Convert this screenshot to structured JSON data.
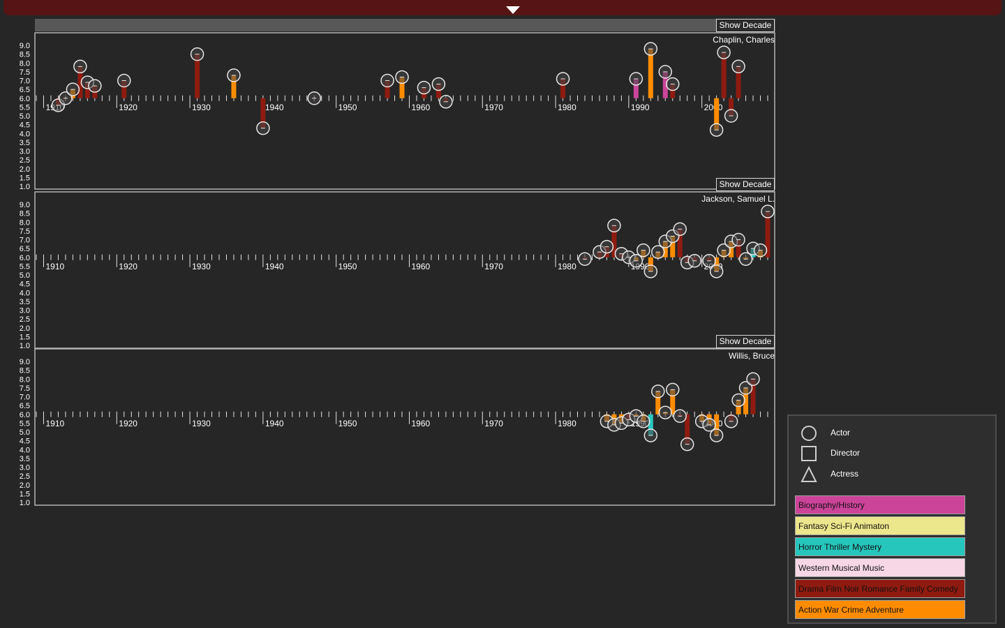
{
  "app": {
    "toggle_icon": "triangle-down-icon",
    "bar_color": "#561414"
  },
  "controls": {
    "show_decade_label": "Show Decade"
  },
  "axis": {
    "y_ticks": [
      "9.0",
      "8.5",
      "8.0",
      "7.5",
      "7.0",
      "6.5",
      "6.0",
      "5.5",
      "5.0",
      "4.5",
      "4.0",
      "3.5",
      "3.0",
      "2.5",
      "2.0",
      "1.5",
      "1.0"
    ],
    "x_decades": [
      "1910",
      "1920",
      "1930",
      "1940",
      "1950",
      "1960",
      "1970",
      "1980",
      "1990",
      "2000"
    ]
  },
  "legend": {
    "roles": [
      {
        "shape": "circle",
        "label": "Actor"
      },
      {
        "shape": "square",
        "label": "Director"
      },
      {
        "shape": "triangle",
        "label": "Actress"
      }
    ],
    "genres": [
      {
        "key": "bio",
        "label": "Biography/History",
        "color": "#cc4499"
      },
      {
        "key": "fantasy",
        "label": "Fantasy Sci-Fi Animaton",
        "color": "#ece68c"
      },
      {
        "key": "horror",
        "label": "Horror Thriller Mystery",
        "color": "#26c6bd"
      },
      {
        "key": "western",
        "label": "Western Musical Music",
        "color": "#f7d7e5"
      },
      {
        "key": "drama",
        "label": "Drama Film Noir Romance Family Comedy",
        "color": "#8f1b10"
      },
      {
        "key": "action",
        "label": "Action War Crime Adventure",
        "color": "#ff8c00"
      }
    ]
  },
  "chart_data": [
    {
      "type": "bar",
      "title": "Chaplin, Charles",
      "xlim": [
        1909,
        2009
      ],
      "ylim": [
        1.0,
        9.0
      ],
      "baseline": 6.0,
      "points": [
        {
          "year": 1912,
          "rating": 5.6,
          "genre": "drama",
          "role": "actor"
        },
        {
          "year": 1913,
          "rating": 6.0,
          "genre": "drama",
          "role": "actor"
        },
        {
          "year": 1914,
          "rating": 6.5,
          "genre": "action",
          "role": "actor"
        },
        {
          "year": 1915,
          "rating": 7.8,
          "genre": "drama",
          "role": "actor"
        },
        {
          "year": 1916,
          "rating": 6.9,
          "genre": "drama",
          "role": "actor"
        },
        {
          "year": 1917,
          "rating": 6.7,
          "genre": "drama",
          "role": "actor"
        },
        {
          "year": 1921,
          "rating": 7.0,
          "genre": "drama",
          "role": "actor"
        },
        {
          "year": 1931,
          "rating": 8.5,
          "genre": "drama",
          "role": "actor"
        },
        {
          "year": 1936,
          "rating": 7.3,
          "genre": "action",
          "role": "actor"
        },
        {
          "year": 1940,
          "rating": 4.3,
          "genre": "drama",
          "role": "actor"
        },
        {
          "year": 1947,
          "rating": 6.0,
          "genre": "drama",
          "role": "actor"
        },
        {
          "year": 1957,
          "rating": 7.0,
          "genre": "drama",
          "role": "actor"
        },
        {
          "year": 1959,
          "rating": 7.2,
          "genre": "action",
          "role": "actor"
        },
        {
          "year": 1962,
          "rating": 6.6,
          "genre": "drama",
          "role": "actor"
        },
        {
          "year": 1964,
          "rating": 6.8,
          "genre": "drama",
          "role": "actor"
        },
        {
          "year": 1965,
          "rating": 5.8,
          "genre": "drama",
          "role": "actor"
        },
        {
          "year": 1981,
          "rating": 7.1,
          "genre": "drama",
          "role": "actor"
        },
        {
          "year": 1991,
          "rating": 7.1,
          "genre": "bio",
          "role": "actor"
        },
        {
          "year": 1993,
          "rating": 8.8,
          "genre": "action",
          "role": "actor"
        },
        {
          "year": 1995,
          "rating": 7.5,
          "genre": "bio",
          "role": "actor"
        },
        {
          "year": 1996,
          "rating": 6.8,
          "genre": "drama",
          "role": "actor"
        },
        {
          "year": 2002,
          "rating": 4.2,
          "genre": "action",
          "role": "actor"
        },
        {
          "year": 2003,
          "rating": 8.6,
          "genre": "drama",
          "role": "actor"
        },
        {
          "year": 2004,
          "rating": 5.0,
          "genre": "drama",
          "role": "actor"
        },
        {
          "year": 2005,
          "rating": 7.8,
          "genre": "drama",
          "role": "actor"
        }
      ]
    },
    {
      "type": "bar",
      "title": "Jackson, Samuel L.",
      "xlim": [
        1909,
        2009
      ],
      "ylim": [
        1.0,
        9.0
      ],
      "baseline": 6.0,
      "points": [
        {
          "year": 1984,
          "rating": 5.9,
          "genre": "drama",
          "role": "actor"
        },
        {
          "year": 1986,
          "rating": 6.3,
          "genre": "drama",
          "role": "actor"
        },
        {
          "year": 1987,
          "rating": 6.6,
          "genre": "drama",
          "role": "actor"
        },
        {
          "year": 1988,
          "rating": 7.8,
          "genre": "drama",
          "role": "actor"
        },
        {
          "year": 1989,
          "rating": 6.2,
          "genre": "drama",
          "role": "actor"
        },
        {
          "year": 1990,
          "rating": 6.0,
          "genre": "drama",
          "role": "actor"
        },
        {
          "year": 1991,
          "rating": 5.8,
          "genre": "action",
          "role": "actor"
        },
        {
          "year": 1992,
          "rating": 6.4,
          "genre": "action",
          "role": "actor"
        },
        {
          "year": 1993,
          "rating": 5.2,
          "genre": "action",
          "role": "actor"
        },
        {
          "year": 1994,
          "rating": 6.3,
          "genre": "action",
          "role": "actor"
        },
        {
          "year": 1995,
          "rating": 6.9,
          "genre": "action",
          "role": "actor"
        },
        {
          "year": 1996,
          "rating": 7.2,
          "genre": "action",
          "role": "actor"
        },
        {
          "year": 1997,
          "rating": 7.6,
          "genre": "drama",
          "role": "actor"
        },
        {
          "year": 1998,
          "rating": 5.7,
          "genre": "drama",
          "role": "actor"
        },
        {
          "year": 1999,
          "rating": 5.8,
          "genre": "drama",
          "role": "actor"
        },
        {
          "year": 2001,
          "rating": 5.8,
          "genre": "drama",
          "role": "actor"
        },
        {
          "year": 2002,
          "rating": 5.2,
          "genre": "action",
          "role": "actor"
        },
        {
          "year": 2003,
          "rating": 6.4,
          "genre": "action",
          "role": "actor"
        },
        {
          "year": 2004,
          "rating": 6.9,
          "genre": "action",
          "role": "actor"
        },
        {
          "year": 2005,
          "rating": 7.0,
          "genre": "drama",
          "role": "actor"
        },
        {
          "year": 2006,
          "rating": 5.9,
          "genre": "action",
          "role": "actor"
        },
        {
          "year": 2007,
          "rating": 6.5,
          "genre": "horror",
          "role": "actor"
        },
        {
          "year": 2008,
          "rating": 6.4,
          "genre": "action",
          "role": "actor"
        },
        {
          "year": 2009,
          "rating": 8.6,
          "genre": "drama",
          "role": "actor"
        }
      ]
    },
    {
      "type": "bar",
      "title": "Willis, Bruce",
      "xlim": [
        1909,
        2009
      ],
      "ylim": [
        1.0,
        9.0
      ],
      "baseline": 6.0,
      "points": [
        {
          "year": 1987,
          "rating": 5.6,
          "genre": "action",
          "role": "actor"
        },
        {
          "year": 1988,
          "rating": 5.4,
          "genre": "action",
          "role": "actor"
        },
        {
          "year": 1989,
          "rating": 5.5,
          "genre": "action",
          "role": "actor"
        },
        {
          "year": 1990,
          "rating": 5.7,
          "genre": "drama",
          "role": "actor"
        },
        {
          "year": 1991,
          "rating": 5.9,
          "genre": "action",
          "role": "actor"
        },
        {
          "year": 1992,
          "rating": 5.6,
          "genre": "action",
          "role": "actor"
        },
        {
          "year": 1993,
          "rating": 4.8,
          "genre": "horror",
          "role": "actor"
        },
        {
          "year": 1994,
          "rating": 7.3,
          "genre": "action",
          "role": "actor"
        },
        {
          "year": 1995,
          "rating": 6.1,
          "genre": "action",
          "role": "actor"
        },
        {
          "year": 1996,
          "rating": 7.4,
          "genre": "action",
          "role": "actor"
        },
        {
          "year": 1997,
          "rating": 5.9,
          "genre": "drama",
          "role": "actor"
        },
        {
          "year": 1998,
          "rating": 4.3,
          "genre": "drama",
          "role": "actor"
        },
        {
          "year": 2000,
          "rating": 5.6,
          "genre": "action",
          "role": "actor"
        },
        {
          "year": 2001,
          "rating": 5.4,
          "genre": "action",
          "role": "actor"
        },
        {
          "year": 2002,
          "rating": 4.8,
          "genre": "action",
          "role": "actor"
        },
        {
          "year": 2004,
          "rating": 5.6,
          "genre": "drama",
          "role": "actor"
        },
        {
          "year": 2005,
          "rating": 6.8,
          "genre": "action",
          "role": "actor"
        },
        {
          "year": 2006,
          "rating": 7.5,
          "genre": "action",
          "role": "actor"
        },
        {
          "year": 2007,
          "rating": 8.0,
          "genre": "drama",
          "role": "actor"
        }
      ]
    }
  ]
}
